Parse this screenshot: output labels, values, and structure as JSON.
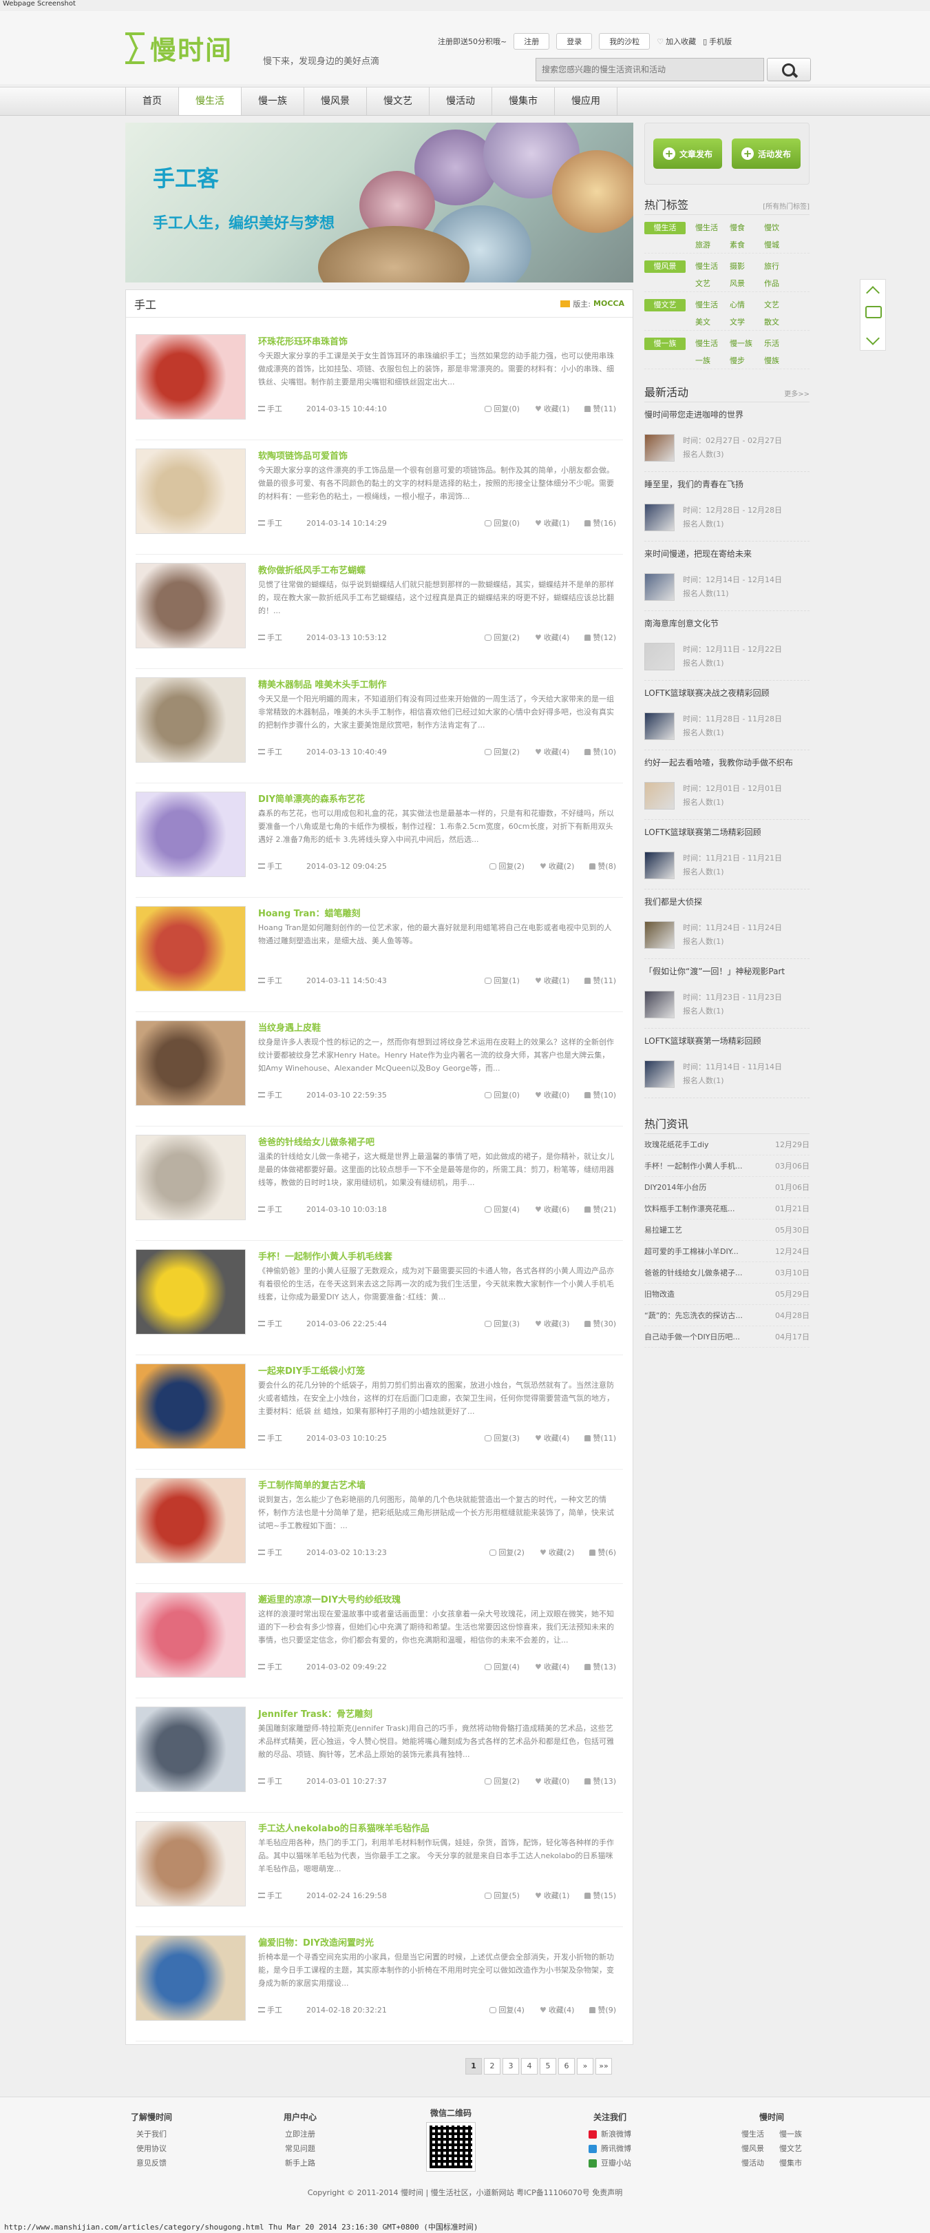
{
  "caption": "Webpage Screenshot",
  "header": {
    "logo": "慢时间",
    "slogan": "慢下来，发现身边的美好点滴",
    "toplinks": {
      "register_tip": "注册即送50分积哦~",
      "register": "注册",
      "login": "登录",
      "my_space": "我的沙粒",
      "favorite": "加入收藏",
      "mobile": "手机版"
    },
    "search_placeholder": "搜索您感兴趣的慢生活资讯和活动"
  },
  "nav": [
    "首页",
    "慢生活",
    "慢一族",
    "慢风景",
    "慢文艺",
    "慢活动",
    "慢集市",
    "慢应用"
  ],
  "banner": {
    "title": "手工客",
    "subtitle": "手工人生，编织美好与梦想"
  },
  "section": {
    "title": "手工",
    "moderator_label": "版主:",
    "moderator": "MOCCA"
  },
  "articles": [
    {
      "title": "环珠花形珏环串珠首饰",
      "excerpt": "今天跟大家分享的手工课是关于女生首饰耳环的串珠编织手工；当然如果您的动手能力强，也可以使用串珠做成漂亮的首饰，比如挂坠、项链、衣服包包上的装饰，那是非常漂亮的。需要的材料有：小小的串珠、细铁丝、尖嘴钳。制作前主要是用尖嘴钳和细铁丝固定出大...",
      "cat": "手工",
      "time": "2014-03-15 10:44:10",
      "comment": "回复(0)",
      "fav": "收藏(1)",
      "like": "赞(11)"
    },
    {
      "title": "软陶项链饰品可爱首饰",
      "excerpt": "今天跟大家分享的这件漂亮的手工饰品是一个很有创意可爱的项链饰品。制作及其的简单，小朋友都会做。做最的很多可爱、有各不同颜色的黏土的文字的材料是选择的粘土，按照的形接全让整体细分不少呢。需要的材料有：一些彩色的粘土，一根绳线，一根小棍子，串润饰...",
      "cat": "手工",
      "time": "2014-03-14 10:14:29",
      "comment": "回复(0)",
      "fav": "收藏(1)",
      "like": "赞(16)"
    },
    {
      "title": "教你做折纸风手工布艺蝴蝶",
      "excerpt": "见惯了往常做的蝴蝶结，似乎说到蝴蝶结人们就只能想到那样的一款蝴蝶结，其实，蝴蝶结并不是单的那样的，现在教大家一款折纸风手工布艺蝴蝶结，这个过程真是真正的蝴蝶结来的呀更不好，蝴蝶结应该总比翻的！...",
      "cat": "手工",
      "time": "2014-03-13 10:53:12",
      "comment": "回复(2)",
      "fav": "收藏(4)",
      "like": "赞(12)"
    },
    {
      "title": "精美木器制品 唯美木头手工制作",
      "excerpt": "今天又是一个阳光明媚的周末，不知道朋们有没有同过些来开始做的一周生活了，今天给大家带来的是一组非常精致的木器制品，唯美的木头手工制作，相信喜欢他们已经过如大家的心情中会好得多吧，也没有真实的把制作步骤什么的，大家主要美饱是欣赏吧，制作方法肯定有了...",
      "cat": "手工",
      "time": "2014-03-13 10:40:49",
      "comment": "回复(2)",
      "fav": "收藏(4)",
      "like": "赞(10)"
    },
    {
      "title": "DIY简单漂亮的森系布艺花",
      "excerpt": "森系的布艺花，也可以用成包和礼盒的花，其实做法也是最基本一样的，只是有和花瓣数，不好缝吗，所以要准备一个八角或是七角的卡纸作为模板，制作过程：1.布条2.5cm宽度，60cm长度，对折下有新用双头遇好 2.准备7角形的纸卡 3.先将线头穿入中间孔中间后，然后选...",
      "cat": "手工",
      "time": "2014-03-12 09:04:25",
      "comment": "回复(2)",
      "fav": "收藏(2)",
      "like": "赞(8)"
    },
    {
      "title": "Hoang Tran：蜡笔雕刻",
      "excerpt": "Hoang Tran是如何雕刻创作的一位艺术家，他的最大喜好就是利用蜡笔将自己在电影或者电视中见到的人物通过雕刻塑造出来，是细大战、美人鱼等等。",
      "cat": "手工",
      "time": "2014-03-11 14:50:43",
      "comment": "回复(1)",
      "fav": "收藏(1)",
      "like": "赞(11)"
    },
    {
      "title": "当纹身遇上皮鞋",
      "excerpt": "纹身是许多人表现个性的标记的之一，然而你有想到过将纹身艺术运用在皮鞋上的效果么？这样的全新创作纹计要都被纹身艺术家Henry Hate。Henry Hate作为业内著名一流的纹身大师，其客户也是大牌云集，如Amy Winehouse、Alexander McQueen以及Boy George等，而...",
      "cat": "手工",
      "time": "2014-03-10 22:59:35",
      "comment": "回复(0)",
      "fav": "收藏(0)",
      "like": "赞(10)"
    },
    {
      "title": "爸爸的针线给女儿做条裙子吧",
      "excerpt": "温柔的针线给女儿做一条裙子，这大概是世界上最温馨的事情了吧，如此做成的裙子，是你精补，就让女儿是最的体做裙都要好最。这里面的比较点想手一下不全是最等是你的，所需工具：剪刀，粉笔等，缝纫用器线等，教做的日时时1块，家用缝纫机，如果没有缝纫机，用手...",
      "cat": "手工",
      "time": "2014-03-10 10:03:18",
      "comment": "回复(4)",
      "fav": "收藏(6)",
      "like": "赞(21)"
    },
    {
      "title": "手杯！一起制作小黄人手机毛线套",
      "excerpt": "《神偷奶爸》里的小黄人征服了无数观众，成为对下最需要买回的卡通人物，各式各样的小黄人周边产品亦有着很伦的生活，在冬天这到来去这之际再一次的成为我们生活里，今天就来教大家制作一个小黄人手机毛线套，让你成为最爱DIY 达人，你需要准备：·红线：黄...",
      "cat": "手工",
      "time": "2014-03-06 22:25:44",
      "comment": "回复(3)",
      "fav": "收藏(3)",
      "like": "赞(30)"
    },
    {
      "title": "一起来DIY手工纸袋小灯笼",
      "excerpt": "要会什么的花几分钟的个纸袋子，用剪刀剪们剪出喜欢的图案，放进小烛台，气氛恐然就有了。当然注意防火或者蜡烛，在安全上小烛台，这样的灯在后面门口走廊，衣架卫生间，任何你觉得需要营造气氛的地方，主要材料：纸袋 丝 蜡烛，如果有那种打子用的小蜡烛就更好了...",
      "cat": "手工",
      "time": "2014-03-03 10:10:25",
      "comment": "回复(3)",
      "fav": "收藏(4)",
      "like": "赞(11)"
    },
    {
      "title": "手工制作简单的复古艺术墙",
      "excerpt": "说到复古，怎么能少了色彩艳丽的几何图形，简单的几个色块就能营造出一个复古的时代，一种文艺的情怀，制作方法也是十分简单了是，把彩纸贴成三角形拼贴成一个长方形用框缝就能来装饰了，简单，快来试试吧~手工教程如下面：...",
      "cat": "手工",
      "time": "2014-03-02 10:13:23",
      "comment": "回复(2)",
      "fav": "收藏(2)",
      "like": "赞(6)"
    },
    {
      "title": "邂逅里的凉凉一DIY大号约纱纸玫瑰",
      "excerpt": "这样的浪漫时常出现在爱温故事中或者童话画面里：小女孩拿着一朵大号玫瑰花，闭上双眼在微笑，她不知道的下一秒会有多少惊喜，但她们心中充满了期待和希望。生活也常要因这份惊喜来，我们无法预知未来的事情，也只要坚定信念，你们都会有爱的，你也充满期和温暖，相信你的未来不会差的，让...",
      "cat": "手工",
      "time": "2014-03-02 09:49:22",
      "comment": "回复(4)",
      "fav": "收藏(4)",
      "like": "赞(13)"
    },
    {
      "title": "Jennifer Trask：骨艺雕刻",
      "excerpt": "美国雕刻家雕塑师-特拉斯克(Jennifer Trask)用自己的巧手，竟然将动物骨骼打造成精美的艺术品，这些艺术品样式精美，匠心独运，令人赞心悦目。她能将嘴心雕刻成为各式各样的艺术品外和都是红色，包括可雅敝的尽品、项链、胸针等，艺术品上原始的装饰元素具有独特...",
      "cat": "手工",
      "time": "2014-03-01 10:27:37",
      "comment": "回复(2)",
      "fav": "收藏(0)",
      "like": "赞(13)"
    },
    {
      "title": "手工达人nekolabo的日系猫咪羊毛毡作品",
      "excerpt": "羊毛毡应用各种，热门的手工门，利用羊毛材料制作玩偶，娃娃，杂货，首饰，配饰，轻化等各种样的手作品。其中以猫咪羊毛毡为代表，当你最手工之家。 今天分享的就是来自日本手工达人nekolabo的日系猫咪羊毛毡作品，嗯嗯萌宠...",
      "cat": "手工",
      "time": "2014-02-24 16:29:58",
      "comment": "回复(5)",
      "fav": "收藏(1)",
      "like": "赞(15)"
    },
    {
      "title": "偏爱旧物：DIY改造闲置时光",
      "excerpt": "折椅本是一个寻香空间充实用的小家具，但是当它闲置的时候，上述优点便会全部消失，开发小折物的新功能，是今日手工课程的主题，其实原本制作的小折椅在不用用时完全可以做如改造作为小书架及杂物架，变身成为新的家居实用摆设...",
      "cat": "手工",
      "time": "2014-02-18 20:32:21",
      "comment": "回复(4)",
      "fav": "收藏(4)",
      "like": "赞(9)"
    }
  ],
  "pager": [
    "1",
    "2",
    "3",
    "4",
    "5",
    "6",
    "»",
    "»»"
  ],
  "sidebar": {
    "publish_article": "文章发布",
    "publish_event": "活动发布",
    "hot_tags": {
      "title": "热门标签",
      "more": "[所有热门标签]",
      "groups": [
        {
          "cat": "慢生活",
          "tags": [
            "慢生活",
            "慢食",
            "慢饮",
            "旅游",
            "素食",
            "慢城"
          ]
        },
        {
          "cat": "慢风景",
          "tags": [
            "慢生活",
            "摄影",
            "旅行",
            "文艺",
            "风景",
            "作品"
          ]
        },
        {
          "cat": "慢文艺",
          "tags": [
            "慢生活",
            "心情",
            "文艺",
            "美文",
            "文学",
            "散文"
          ]
        },
        {
          "cat": "慢一族",
          "tags": [
            "慢生活",
            "慢一族",
            "乐活",
            "一族",
            "慢步",
            "慢族"
          ]
        }
      ]
    },
    "events": {
      "title": "最新活动",
      "more": "更多>>",
      "time_label": "时间：",
      "items": [
        {
          "title": "慢时间带您走进咖啡的世界",
          "time": "02月27日 - 02月27日",
          "count": "报名人数(3)"
        },
        {
          "title": "睡至里，我们的青春在飞扬",
          "time": "12月28日 - 12月28日",
          "count": "报名人数(1)"
        },
        {
          "title": "来时间慢递，把现在寄给未来",
          "time": "12月14日 - 12月14日",
          "count": "报名人数(11)"
        },
        {
          "title": "南海意库创意文化节",
          "time": "12月11日 - 12月22日",
          "count": "报名人数(1)"
        },
        {
          "title": "LOFTK篮球联赛决战之夜精彩回顾",
          "time": "11月28日 - 11月28日",
          "count": "报名人数(1)"
        },
        {
          "title": "约好一起去看哈喳，我教你动手做不织布",
          "time": "12月01日 - 12月01日",
          "count": "报名人数(1)"
        },
        {
          "title": "LOFTK篮球联赛第二场精彩回顾",
          "time": "11月21日 - 11月21日",
          "count": "报名人数(1)"
        },
        {
          "title": "我们都是大侦探",
          "time": "11月24日 - 11月24日",
          "count": "报名人数(1)"
        },
        {
          "title": "「假如让你“渡”一回！」神秘观影Part",
          "time": "11月23日 - 11月23日",
          "count": "报名人数(1)"
        },
        {
          "title": "LOFTK篮球联赛第一场精彩回顾",
          "time": "11月14日 - 11月14日",
          "count": "报名人数(1)"
        }
      ]
    },
    "news": {
      "title": "热门资讯",
      "items": [
        {
          "title": "玫瑰花纸花手工diy",
          "date": "12月29日"
        },
        {
          "title": "手杯！一起制作小黄人手机...",
          "date": "03月06日"
        },
        {
          "title": "DIY2014年小台历",
          "date": "01月06日"
        },
        {
          "title": "饮料瓶手工制作漂亮花瓶...",
          "date": "01月21日"
        },
        {
          "title": "易拉罐工艺",
          "date": "05月30日"
        },
        {
          "title": "超可爱的手工棉袜小羊DIY...",
          "date": "12月24日"
        },
        {
          "title": "爸爸的针线给女儿做条裙子...",
          "date": "03月10日"
        },
        {
          "title": "旧物改造",
          "date": "05月29日"
        },
        {
          "title": "“蔬”的：先忘洗衣的探访古...",
          "date": "04月28日"
        },
        {
          "title": "自己动手做一个DIY日历吧...",
          "date": "04月17日"
        }
      ]
    }
  },
  "footer": {
    "about": {
      "title": "了解慢时间",
      "links": [
        "关于我们",
        "使用协议",
        "意见反馈"
      ]
    },
    "user": {
      "title": "用户中心",
      "links": [
        "立即注册",
        "常见问题",
        "新手上路"
      ]
    },
    "qr": {
      "title": "微信二维码"
    },
    "follow": {
      "title": "关注我们",
      "links": [
        "新浪微博",
        "腾讯微博",
        "豆瓣小站"
      ]
    },
    "columns": {
      "title": "慢时间",
      "links": [
        "慢生活",
        "慢一族",
        "慢风景",
        "慢文艺",
        "慢活动",
        "慢集市"
      ]
    },
    "copyright": "Copyright © 2011-2014 慢时间 | 慢生活社区，小道新网站 粤ICP备11106070号    免责声明"
  },
  "status_bar": "http://www.manshijian.com/articles/category/shougong.html Thu Mar 20 2014 23:16:30 GMT+0800 (中国标准时间)",
  "colors": {
    "accent": "#8cc63f",
    "link": "#6a9e1f",
    "banner_text": "#18a0c8"
  }
}
